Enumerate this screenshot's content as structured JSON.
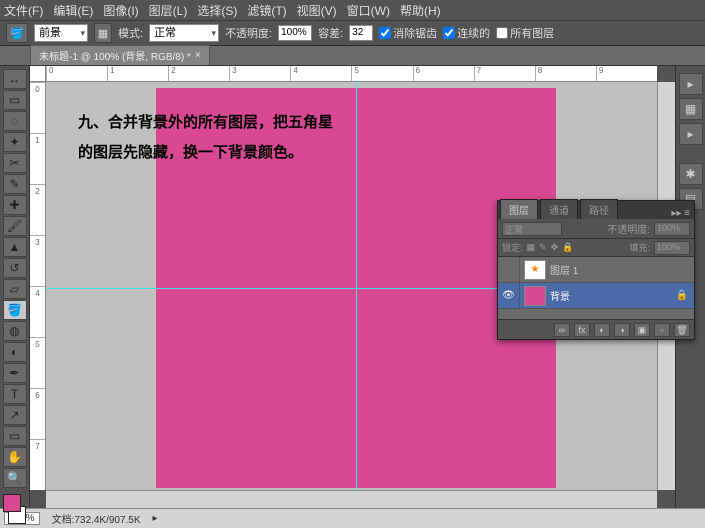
{
  "menu": [
    "文件(F)",
    "编辑(E)",
    "图像(I)",
    "图层(L)",
    "选择(S)",
    "滤镜(T)",
    "视图(V)",
    "窗口(W)",
    "帮助(H)"
  ],
  "opt": {
    "layer_sel": "前景",
    "mode_label": "模式:",
    "mode_val": "正常",
    "opacity_label": "不透明度:",
    "opacity_val": "100%",
    "tol_label": "容差:",
    "tol_val": "32",
    "aa": "消除锯齿",
    "contig": "连续的",
    "alllayers": "所有图层"
  },
  "doc_tab": "未标题-1 @ 100% (背景, RGB/8) *",
  "ruler_h": [
    "0",
    "1",
    "2",
    "3",
    "4",
    "5",
    "6",
    "7",
    "8",
    "9"
  ],
  "ruler_v": [
    "0",
    "1",
    "2",
    "3",
    "4",
    "5",
    "6",
    "7"
  ],
  "annotation_l1": "九、合并背景外的所有图层，把五角星",
  "annotation_l2": "的图层先隐藏，换一下背景颜色。",
  "layers": {
    "tabs": [
      "图层",
      "通道",
      "路径"
    ],
    "blend": "正常",
    "opacity_label": "不透明度:",
    "opacity_val": "100%",
    "lock_label": "锁定:",
    "fill_label": "填充:",
    "fill_val": "100%",
    "rows": [
      {
        "name": "图层 1",
        "visible": false,
        "selected": false,
        "thumb": "star"
      },
      {
        "name": "背景",
        "visible": true,
        "selected": true,
        "thumb": "pink"
      }
    ]
  },
  "status": {
    "zoom": "100%",
    "docsize": "文档:732.4K/907.5K"
  },
  "colors": {
    "fg": "#d94893"
  }
}
